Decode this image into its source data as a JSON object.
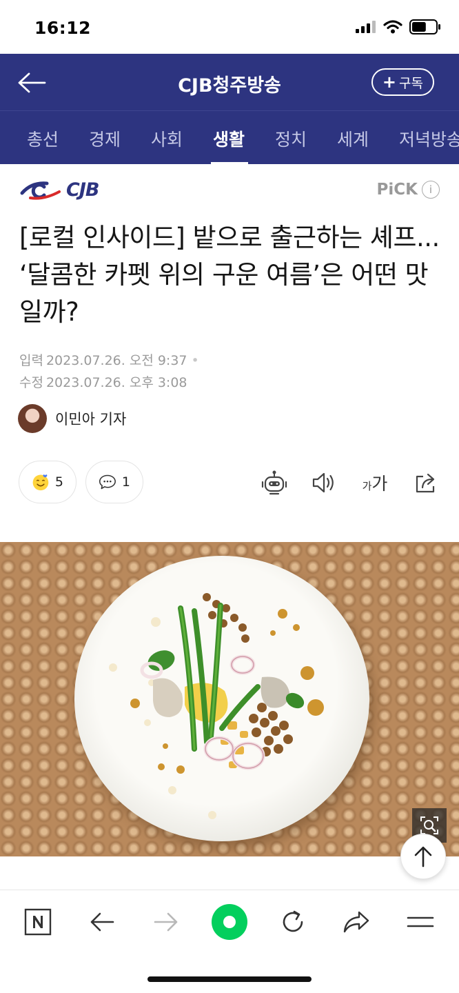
{
  "status_bar": {
    "time": "16:12",
    "battery_level": 0.6
  },
  "header": {
    "title": "CJB청주방송",
    "subscribe_label": "구독"
  },
  "tabs": [
    {
      "label": "총선"
    },
    {
      "label": "경제"
    },
    {
      "label": "사회"
    },
    {
      "label": "생활",
      "active": true
    },
    {
      "label": "정치"
    },
    {
      "label": "세계"
    },
    {
      "label": "저녁방송"
    }
  ],
  "press": {
    "logo_text": "CJB",
    "pick_label": "PiCK",
    "info_glyph": "i"
  },
  "article": {
    "headline": "[로컬 인사이드] 밭으로 출근하는 셰프... ‘달콤한 카펫 위의 구운 여름’은 어떤 맛일까?",
    "input_label": "입력",
    "input_date": "2023.07.26. 오전 9:37",
    "modified_label": "수정",
    "modified_date": "2023.07.26. 오후 3:08",
    "reporter": "이민아 기자"
  },
  "actions": {
    "reaction_count": "5",
    "comment_count": "1",
    "font_size_small": "가",
    "font_size_large": "가"
  },
  "icons": {
    "back": "arrow-left-icon",
    "reaction": "smile-emoji-icon",
    "comment": "speech-bubble-icon",
    "summary": "robot-icon",
    "tts": "speaker-icon",
    "share": "share-icon",
    "zoom": "zoom-icon",
    "scroll_top": "arrow-up-icon"
  },
  "colors": {
    "header_bg": "#2d3480",
    "accent_green": "#03cf5d",
    "logo_blue": "#2d3480"
  }
}
